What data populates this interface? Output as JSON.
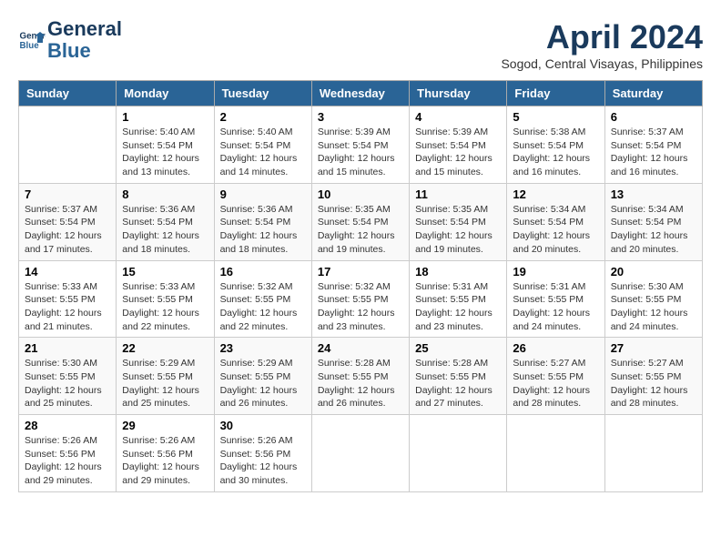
{
  "header": {
    "logo_line1": "General",
    "logo_line2": "Blue",
    "month": "April 2024",
    "location": "Sogod, Central Visayas, Philippines"
  },
  "days_of_week": [
    "Sunday",
    "Monday",
    "Tuesday",
    "Wednesday",
    "Thursday",
    "Friday",
    "Saturday"
  ],
  "weeks": [
    [
      {
        "day": "",
        "info": ""
      },
      {
        "day": "1",
        "info": "Sunrise: 5:40 AM\nSunset: 5:54 PM\nDaylight: 12 hours\nand 13 minutes."
      },
      {
        "day": "2",
        "info": "Sunrise: 5:40 AM\nSunset: 5:54 PM\nDaylight: 12 hours\nand 14 minutes."
      },
      {
        "day": "3",
        "info": "Sunrise: 5:39 AM\nSunset: 5:54 PM\nDaylight: 12 hours\nand 15 minutes."
      },
      {
        "day": "4",
        "info": "Sunrise: 5:39 AM\nSunset: 5:54 PM\nDaylight: 12 hours\nand 15 minutes."
      },
      {
        "day": "5",
        "info": "Sunrise: 5:38 AM\nSunset: 5:54 PM\nDaylight: 12 hours\nand 16 minutes."
      },
      {
        "day": "6",
        "info": "Sunrise: 5:37 AM\nSunset: 5:54 PM\nDaylight: 12 hours\nand 16 minutes."
      }
    ],
    [
      {
        "day": "7",
        "info": "Sunrise: 5:37 AM\nSunset: 5:54 PM\nDaylight: 12 hours\nand 17 minutes."
      },
      {
        "day": "8",
        "info": "Sunrise: 5:36 AM\nSunset: 5:54 PM\nDaylight: 12 hours\nand 18 minutes."
      },
      {
        "day": "9",
        "info": "Sunrise: 5:36 AM\nSunset: 5:54 PM\nDaylight: 12 hours\nand 18 minutes."
      },
      {
        "day": "10",
        "info": "Sunrise: 5:35 AM\nSunset: 5:54 PM\nDaylight: 12 hours\nand 19 minutes."
      },
      {
        "day": "11",
        "info": "Sunrise: 5:35 AM\nSunset: 5:54 PM\nDaylight: 12 hours\nand 19 minutes."
      },
      {
        "day": "12",
        "info": "Sunrise: 5:34 AM\nSunset: 5:54 PM\nDaylight: 12 hours\nand 20 minutes."
      },
      {
        "day": "13",
        "info": "Sunrise: 5:34 AM\nSunset: 5:54 PM\nDaylight: 12 hours\nand 20 minutes."
      }
    ],
    [
      {
        "day": "14",
        "info": "Sunrise: 5:33 AM\nSunset: 5:55 PM\nDaylight: 12 hours\nand 21 minutes."
      },
      {
        "day": "15",
        "info": "Sunrise: 5:33 AM\nSunset: 5:55 PM\nDaylight: 12 hours\nand 22 minutes."
      },
      {
        "day": "16",
        "info": "Sunrise: 5:32 AM\nSunset: 5:55 PM\nDaylight: 12 hours\nand 22 minutes."
      },
      {
        "day": "17",
        "info": "Sunrise: 5:32 AM\nSunset: 5:55 PM\nDaylight: 12 hours\nand 23 minutes."
      },
      {
        "day": "18",
        "info": "Sunrise: 5:31 AM\nSunset: 5:55 PM\nDaylight: 12 hours\nand 23 minutes."
      },
      {
        "day": "19",
        "info": "Sunrise: 5:31 AM\nSunset: 5:55 PM\nDaylight: 12 hours\nand 24 minutes."
      },
      {
        "day": "20",
        "info": "Sunrise: 5:30 AM\nSunset: 5:55 PM\nDaylight: 12 hours\nand 24 minutes."
      }
    ],
    [
      {
        "day": "21",
        "info": "Sunrise: 5:30 AM\nSunset: 5:55 PM\nDaylight: 12 hours\nand 25 minutes."
      },
      {
        "day": "22",
        "info": "Sunrise: 5:29 AM\nSunset: 5:55 PM\nDaylight: 12 hours\nand 25 minutes."
      },
      {
        "day": "23",
        "info": "Sunrise: 5:29 AM\nSunset: 5:55 PM\nDaylight: 12 hours\nand 26 minutes."
      },
      {
        "day": "24",
        "info": "Sunrise: 5:28 AM\nSunset: 5:55 PM\nDaylight: 12 hours\nand 26 minutes."
      },
      {
        "day": "25",
        "info": "Sunrise: 5:28 AM\nSunset: 5:55 PM\nDaylight: 12 hours\nand 27 minutes."
      },
      {
        "day": "26",
        "info": "Sunrise: 5:27 AM\nSunset: 5:55 PM\nDaylight: 12 hours\nand 28 minutes."
      },
      {
        "day": "27",
        "info": "Sunrise: 5:27 AM\nSunset: 5:55 PM\nDaylight: 12 hours\nand 28 minutes."
      }
    ],
    [
      {
        "day": "28",
        "info": "Sunrise: 5:26 AM\nSunset: 5:56 PM\nDaylight: 12 hours\nand 29 minutes."
      },
      {
        "day": "29",
        "info": "Sunrise: 5:26 AM\nSunset: 5:56 PM\nDaylight: 12 hours\nand 29 minutes."
      },
      {
        "day": "30",
        "info": "Sunrise: 5:26 AM\nSunset: 5:56 PM\nDaylight: 12 hours\nand 30 minutes."
      },
      {
        "day": "",
        "info": ""
      },
      {
        "day": "",
        "info": ""
      },
      {
        "day": "",
        "info": ""
      },
      {
        "day": "",
        "info": ""
      }
    ]
  ]
}
